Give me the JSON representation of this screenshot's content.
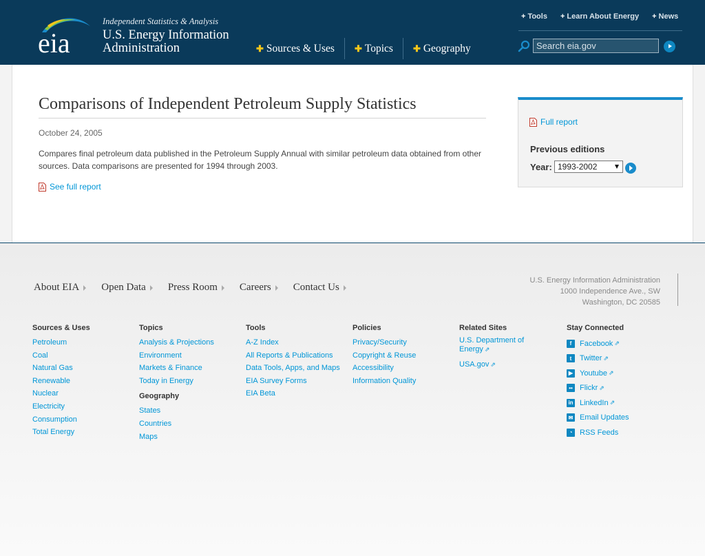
{
  "header": {
    "tagline": "Independent Statistics & Analysis",
    "org_name": "U.S. Energy Information Administration",
    "logo_text": "eia",
    "main_nav": [
      "Sources & Uses",
      "Topics",
      "Geography"
    ],
    "util_nav": [
      "Tools",
      "Learn About Energy",
      "News"
    ],
    "search_placeholder": "Search eia.gov"
  },
  "article": {
    "title": "Comparisons of Independent Petroleum Supply Statistics",
    "date": "October 24, 2005",
    "description": "Compares final petroleum data published in the Petroleum Supply Annual with similar petroleum data obtained from other sources. Data comparisons are presented for 1994 through 2003.",
    "see_full_report": "See full report"
  },
  "sidebar": {
    "full_report": "Full report",
    "previous_editions": "Previous editions",
    "year_label": "Year:",
    "year_selected": "1993-2002"
  },
  "footer": {
    "nav": [
      "About EIA",
      "Open Data",
      "Press Room",
      "Careers",
      "Contact Us"
    ],
    "address": [
      "U.S. Energy Information Administration",
      "1000 Independence Ave., SW",
      "Washington, DC 20585"
    ],
    "sources": {
      "title": "Sources & Uses",
      "links": [
        "Petroleum",
        "Coal",
        "Natural Gas",
        "Renewable",
        "Nuclear",
        "Electricity",
        "Consumption",
        "Total Energy"
      ]
    },
    "topics": {
      "title": "Topics",
      "links": [
        "Analysis & Projections",
        "Environment",
        "Markets & Finance",
        "Today in Energy"
      ]
    },
    "geography": {
      "title": "Geography",
      "links": [
        "States",
        "Countries",
        "Maps"
      ]
    },
    "tools": {
      "title": "Tools",
      "links": [
        "A-Z Index",
        "All Reports & Publications",
        "Data Tools, Apps, and Maps",
        "EIA Survey Forms",
        "EIA Beta"
      ]
    },
    "policies": {
      "title": "Policies",
      "links": [
        "Privacy/Security",
        "Copyright & Reuse",
        "Accessibility",
        "Information Quality"
      ]
    },
    "related": {
      "title": "Related Sites",
      "links": [
        "U.S. Department of Energy",
        "USA.gov"
      ]
    },
    "social": {
      "title": "Stay Connected",
      "links": [
        "Facebook",
        "Twitter",
        "Youtube",
        "Flickr",
        "LinkedIn",
        "Email Updates",
        "RSS Feeds"
      ]
    }
  }
}
